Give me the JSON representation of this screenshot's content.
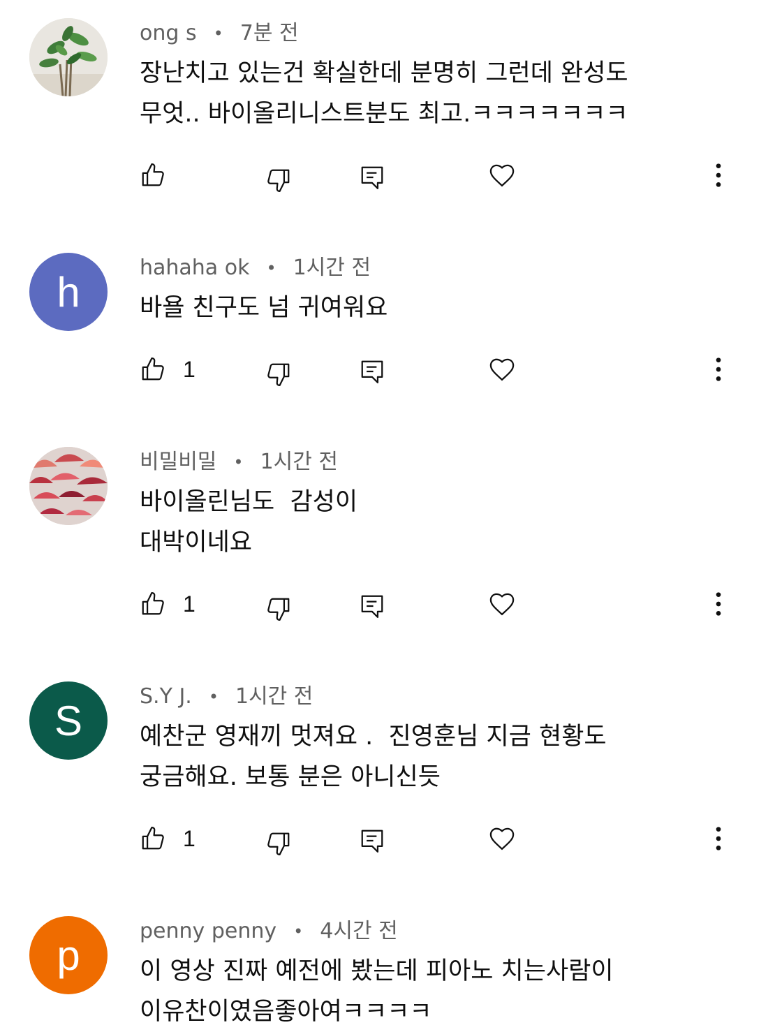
{
  "comments": [
    {
      "author": "ong s",
      "time": "7분 전",
      "text": "장난치고 있는건 확실한데 분명히 그런데 완성도\n무엇.. 바이올리니스트분도 최고.ㅋㅋㅋㅋㅋㅋㅋ",
      "likes": "",
      "avatar": {
        "type": "image",
        "subject": "potted-plant"
      }
    },
    {
      "author": "hahaha ok",
      "time": "1시간 전",
      "text": "바욜 친구도 넘 귀여워요",
      "likes": "1",
      "avatar": {
        "type": "letter",
        "letter": "h",
        "color": "#5c6bc0"
      }
    },
    {
      "author": "비밀비밀",
      "time": "1시간 전",
      "text": "바이올린님도  감성이\n대박이네요",
      "likes": "1",
      "avatar": {
        "type": "image",
        "subject": "red-umbrellas"
      }
    },
    {
      "author": "S.Y J.",
      "time": "1시간 전",
      "text": "예찬군 영재끼 멋져요 .  진영훈님 지금 현황도\n궁금해요. 보통 분은 아니신듯",
      "likes": "1",
      "avatar": {
        "type": "letter",
        "letter": "S",
        "color": "#0b5a4a"
      }
    },
    {
      "author": "penny penny",
      "time": "4시간 전",
      "text": "이 영상 진짜 예전에 봤는데 피아노 치는사람이\n이유찬이였음좋아여ㅋㅋㅋㅋ",
      "likes": "",
      "avatar": {
        "type": "letter",
        "letter": "p",
        "color": "#ef6c00"
      }
    }
  ],
  "icons": {
    "like": "thumbs-up-icon",
    "dislike": "thumbs-down-icon",
    "reply": "reply-icon",
    "heart": "heart-icon",
    "more": "more-vertical-icon"
  }
}
